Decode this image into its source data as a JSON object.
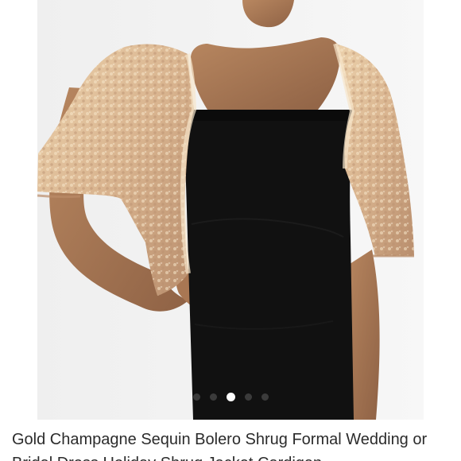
{
  "listing": {
    "title": "Gold Champagne Sequin Bolero Shrug Formal Wedding or Bridal Dress Holiday Shrug Jacket Cardigan",
    "favorite_icon": "heart-outline-icon",
    "image_carousel": {
      "active_index": 2,
      "count": 5
    },
    "colors": {
      "sequin_gold": "#d9b48f",
      "dress_black": "#111111",
      "skin": "#a77a56",
      "background": "#f3f3f3"
    }
  }
}
